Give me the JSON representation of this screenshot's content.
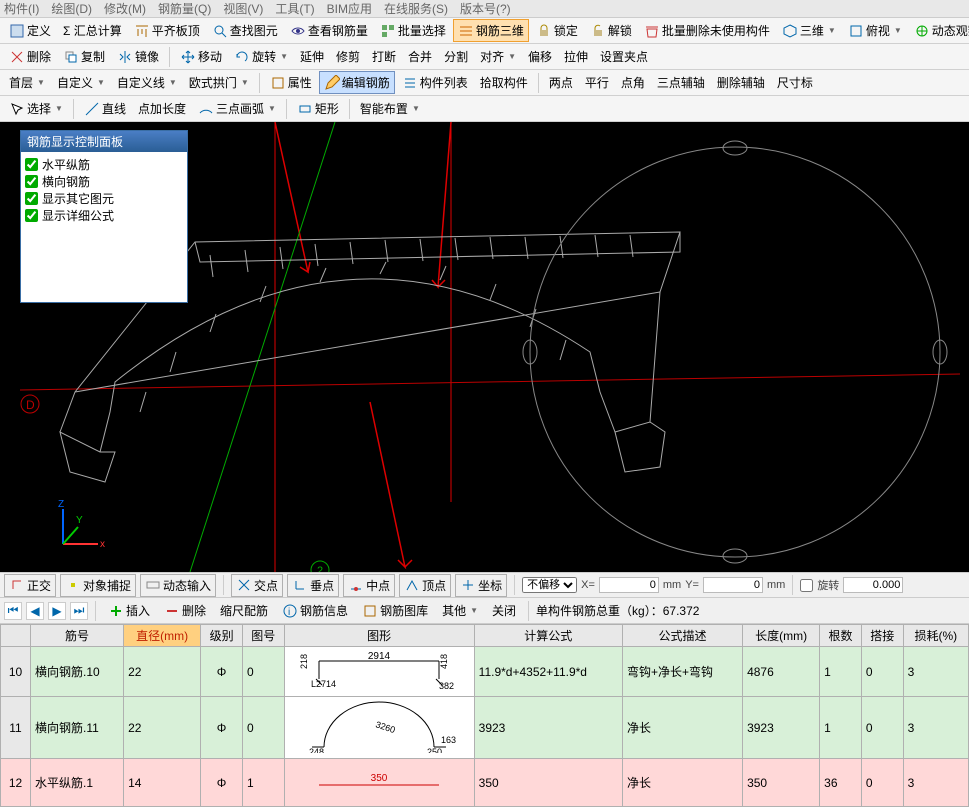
{
  "menubar": [
    "构件(I)",
    "绘图(D)",
    "修改(M)",
    "钢筋量(Q)",
    "视图(V)",
    "工具(T)",
    "BIM应用",
    "在线服务(S)",
    "版本号(?)"
  ],
  "toolbar1": {
    "define": "定义",
    "sum": "Σ 汇总计算",
    "align_top": "平齐板顶",
    "find_elem": "查找图元",
    "view_rebar": "查看钢筋量",
    "batch_sel": "批量选择",
    "rebar_3d": "钢筋三维",
    "lock": "锁定",
    "unlock": "解锁",
    "batch_del": "批量删除未使用构件",
    "three_d": "三维",
    "persp": "俯视",
    "dyn_view": "动态观察"
  },
  "toolbar2": {
    "del": "删除",
    "copy": "复制",
    "mirror": "镜像",
    "move": "移动",
    "rotate": "旋转",
    "extend": "延伸",
    "trim": "修剪",
    "break": "打断",
    "fillet": "合并",
    "split": "分割",
    "align": "对齐",
    "offset": "偏移",
    "stretch": "拉伸",
    "set_grip": "设置夹点"
  },
  "toolbar3": {
    "floor": "首层",
    "custom": "自定义",
    "custom_line": "自定义线",
    "arch": "欧式拱门",
    "attr": "属性",
    "edit_rebar": "编辑钢筋",
    "comp_list": "构件列表",
    "pick_comp": "拾取构件",
    "two_pt": "两点",
    "parallel": "平行",
    "pt_angle": "点角",
    "three_pt_aux": "三点辅轴",
    "del_aux": "删除辅轴",
    "dim": "尺寸标"
  },
  "toolbar4": {
    "select": "选择",
    "line": "直线",
    "pt_len": "点加长度",
    "three_arc": "三点画弧",
    "rect": "矩形",
    "smart": "智能布置"
  },
  "panel": {
    "title": "钢筋显示控制面板",
    "checks": [
      "水平纵筋",
      "横向钢筋",
      "显示其它图元",
      "显示详细公式"
    ]
  },
  "snapbar": {
    "ortho": "正交",
    "osnap": "对象捕捉",
    "dyn": "动态输入",
    "int": "交点",
    "perp": "垂点",
    "mid": "中点",
    "apex": "顶点",
    "coord": "坐标",
    "no_offset": "不偏移",
    "x": "X=",
    "xval": "0",
    "xunit": "mm",
    "y": "Y=",
    "yval": "0",
    "yunit": "mm",
    "rot": "旋转",
    "rotval": "0.000"
  },
  "editbar": {
    "insert": "插入",
    "delete": "删除",
    "scale": "缩尺配筋",
    "rebar_info": "钢筋信息",
    "rebar_lib": "钢筋图库",
    "other": "其他",
    "close": "关闭",
    "total_lbl": "单构件钢筋总重（kg）：",
    "total_val": "67.372"
  },
  "grid": {
    "headers": [
      "筋号",
      "直径(mm)",
      "级别",
      "图号",
      "图形",
      "计算公式",
      "公式描述",
      "长度(mm)",
      "根数",
      "搭接",
      "损耗(%)"
    ],
    "rows": [
      {
        "n": "10",
        "a": "横向钢筋.10",
        "b": "22",
        "c": "Φ",
        "d": "0",
        "shape": {
          "t": "2914",
          "l": "218",
          "lb": "L2714",
          "r": "418",
          "rb": "382"
        },
        "f": "11.9*d+4352+11.9*d",
        "g": "弯钩+净长+弯钩",
        "h": "4876",
        "i": "1",
        "j": "0",
        "k": "3"
      },
      {
        "n": "11",
        "a": "横向钢筋.11",
        "b": "22",
        "c": "Φ",
        "d": "0",
        "shape": {
          "arc": "3260",
          "lb": "248",
          "rb": "250",
          "rt": "163"
        },
        "f": "3923",
        "g": "净长",
        "h": "3923",
        "i": "1",
        "j": "0",
        "k": "3"
      },
      {
        "n": "12",
        "a": "水平纵筋.1",
        "b": "14",
        "c": "Φ",
        "d": "1",
        "shape": {
          "line": "350"
        },
        "f": "350",
        "g": "净长",
        "h": "350",
        "i": "36",
        "j": "0",
        "k": "3"
      }
    ]
  }
}
